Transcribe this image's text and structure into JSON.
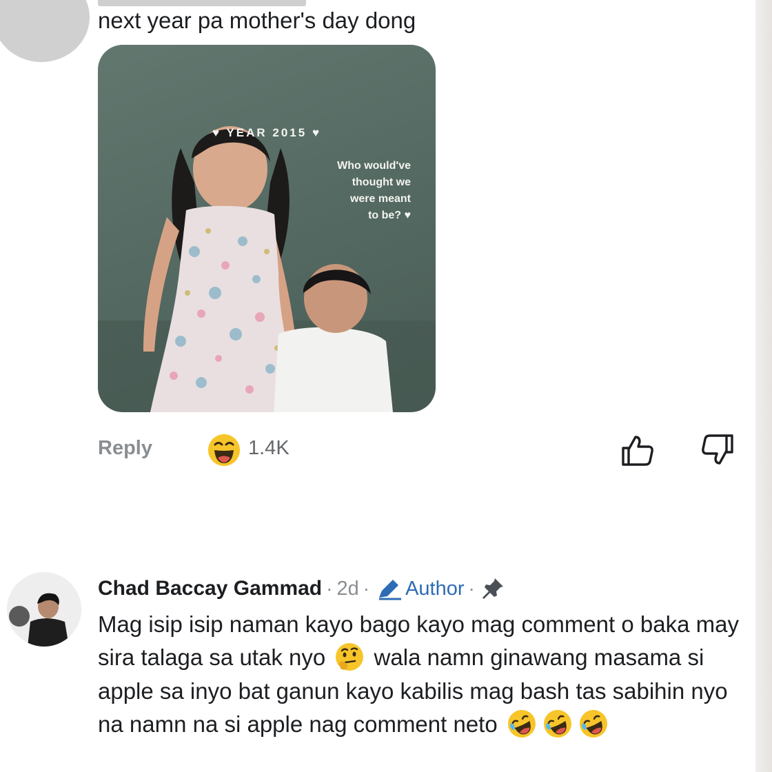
{
  "top_comment": {
    "text": "next year pa mother's day dong",
    "attachment": {
      "year_label": "♥ YEAR 2015 ♥",
      "caption_lines": [
        "Who would've",
        "thought we",
        "were meant",
        "to be? ♥"
      ]
    },
    "actions": {
      "reply_label": "Reply",
      "reaction_icon": "laughing-face-emoji",
      "reaction_count": "1.4K"
    }
  },
  "second_comment": {
    "author": "Chad Baccay Gammad",
    "separator": "·",
    "time": "2d",
    "badge": "Author",
    "body_parts": [
      "Mag isip isip naman kayo bago kayo mag comment o baka may sira talaga sa utak nyo",
      "wala namn ginawang masama si apple sa inyo bat ganun kayo kabilis mag bash tas sabihin nyo na namn na si apple nag comment neto"
    ],
    "body_emojis": {
      "thinking": "thinking-face-emoji",
      "rofl": "rolling-on-floor-laughing-emoji",
      "rofl_count": 3
    }
  },
  "colors": {
    "text_primary": "#1c1e21",
    "text_secondary": "#8a8d91",
    "author_badge": "#2d6cb5",
    "emoji_yellow": "#f7c52a"
  }
}
